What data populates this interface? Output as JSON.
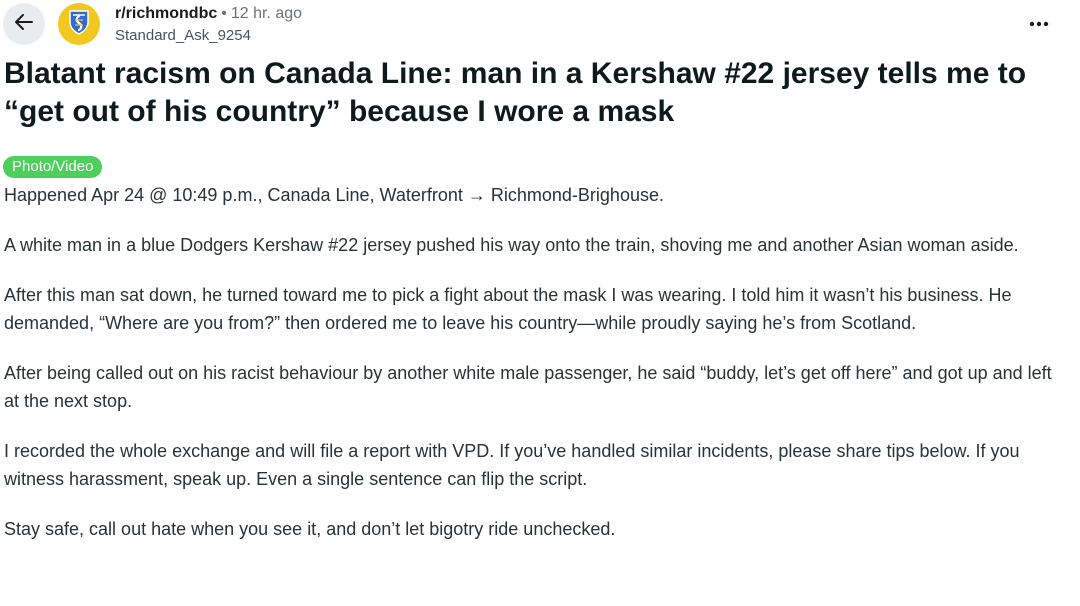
{
  "header": {
    "back_icon": "arrow-left-icon",
    "subreddit_icon": "shield-crest-icon",
    "subreddit": "r/richmondbc",
    "separator": "•",
    "time_ago": "12 hr. ago",
    "author": "Standard_Ask_9254",
    "more_icon": "ellipsis-icon"
  },
  "post": {
    "title": "Blatant racism on Canada Line: man in a Kershaw #22 jersey tells me to “get out of his country” because I wore a mask",
    "flair": "Photo/Video",
    "flair_color": "#4dce5d",
    "paragraphs": [
      "Happened Apr 24 @ 10:49 p.m., Canada Line, Waterfront → Richmond-Brighouse.",
      "A white man in a blue Dodgers Kershaw #22 jersey pushed his way onto the train, shoving me and another Asian woman aside.",
      "After this man sat down, he turned toward me to pick a fight about the mask I was wearing. I told him it wasn’t his business. He demanded, “Where are you from?” then ordered me to leave his country—while proudly saying he’s from Scotland.",
      "After being called out on his racist behaviour by another white male passenger, he said “buddy, let’s get off here” and got up and left at the next stop.",
      "I recorded the whole exchange and will file a report with VPD. If you’ve handled similar incidents, please share tips below. If you witness harassment, speak up. Even a single sentence can flip the script.",
      "Stay safe, call out hate when you see it, and don’t let bigotry ride unchecked."
    ]
  }
}
